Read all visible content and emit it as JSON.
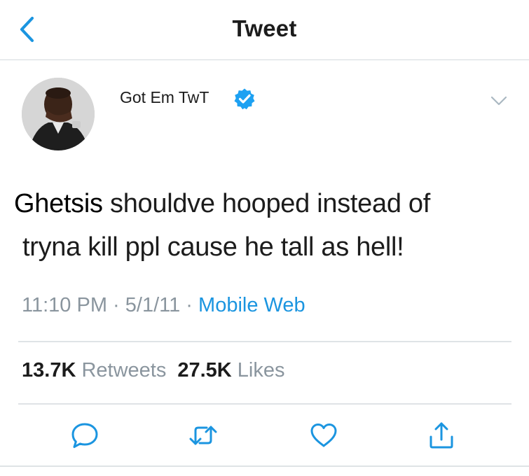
{
  "header": {
    "title": "Tweet"
  },
  "author": {
    "display_name": "Got Em TwT",
    "verified": true
  },
  "tweet": {
    "text_line1_highlight": "Ghetsis",
    "text_line1_rest": " shouldve hooped instead of",
    "text_line2": "tryna kill ppl cause he tall as hell!"
  },
  "meta": {
    "time": "11:10 PM",
    "sep1": " · ",
    "date": "5/1/11",
    "sep2": " · ",
    "source": "Mobile Web"
  },
  "stats": {
    "retweets_count": "13.7K",
    "retweets_label": "Retweets",
    "likes_count": "27.5K",
    "likes_label": "Likes"
  },
  "colors": {
    "link": "#1b95e0",
    "muted": "#8a959e",
    "verified": "#1da1f2",
    "icon": "#1b95e0"
  },
  "icons": [
    "back-chevron-icon",
    "verified-badge-icon",
    "caret-down-icon",
    "reply-icon",
    "retweet-icon",
    "like-icon",
    "share-icon"
  ]
}
